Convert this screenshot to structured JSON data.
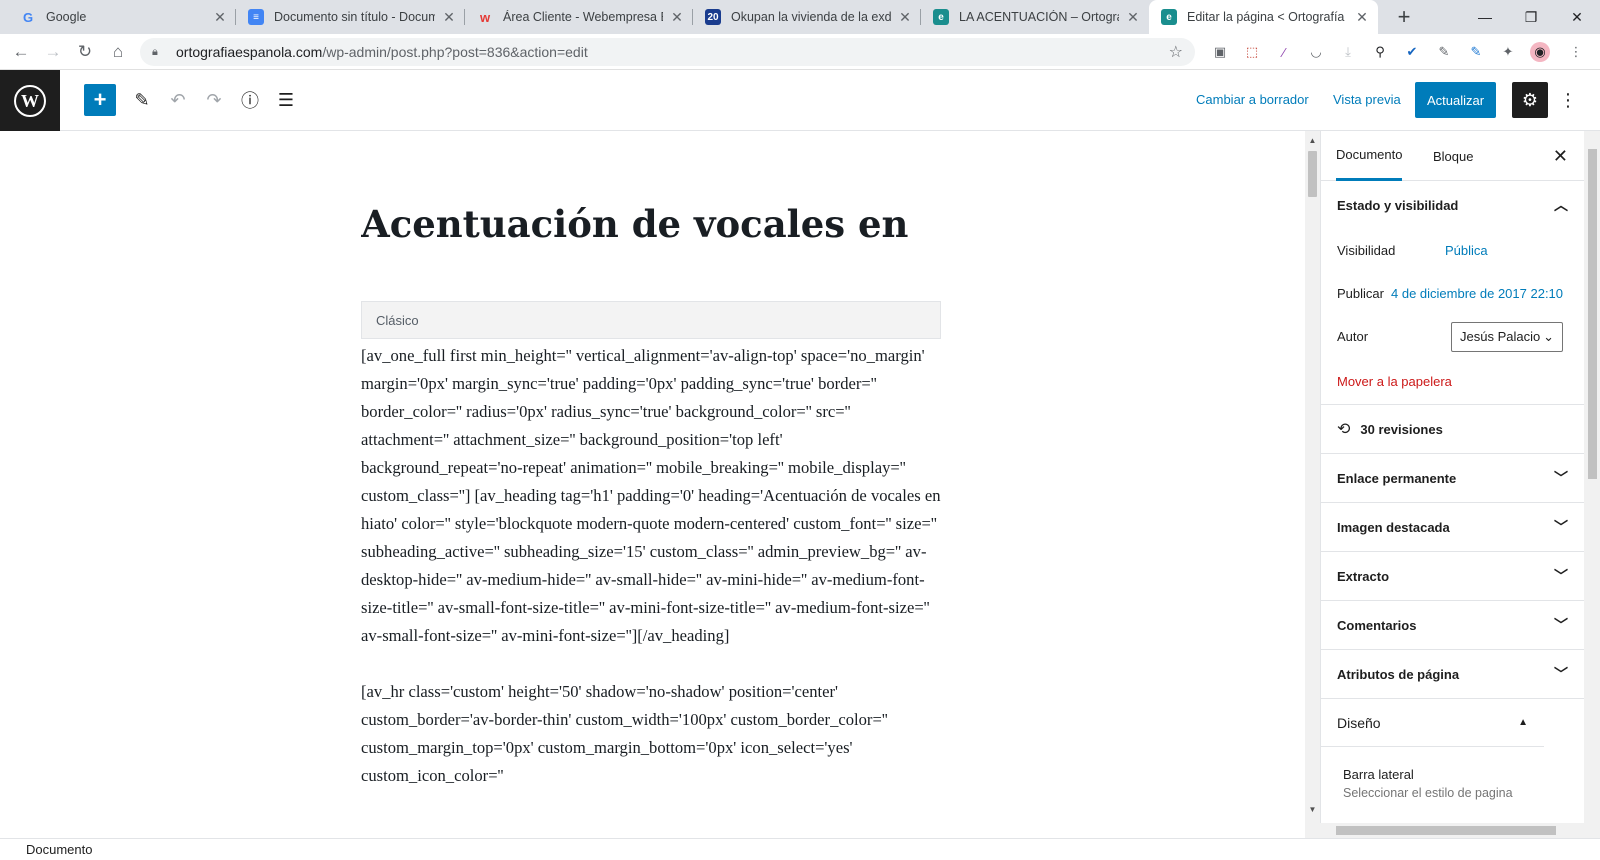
{
  "browser": {
    "tabs": [
      {
        "title": "Google",
        "favicon": "G",
        "favicon_color": "#4285f4"
      },
      {
        "title": "Documento sin título - Docum",
        "favicon": "≡",
        "favicon_color": "#4285f4"
      },
      {
        "title": "Área Cliente - Webempresa Eu",
        "favicon": "w",
        "favicon_color": "#e53935"
      },
      {
        "title": "Okupan la vivienda de la exdiri",
        "favicon": "20",
        "favicon_color": "#1a3c8e"
      },
      {
        "title": "LA ACENTUACIÓN – Ortografía",
        "favicon": "e",
        "favicon_color": "#1a8e8e"
      },
      {
        "title": "Editar la página < Ortografía e",
        "favicon": "e",
        "favicon_color": "#1a8e8e"
      }
    ],
    "url_host": "ortografiaespanola.com",
    "url_path": "/wp-admin/post.php?post=836&action=edit"
  },
  "wp_toolbar": {
    "switch_draft": "Cambiar a borrador",
    "preview": "Vista previa",
    "update": "Actualizar"
  },
  "editor": {
    "title": "Acentuación de vocales en hiato",
    "block_label": "Clásico",
    "paragraphs": [
      "[av_one_full first min_height='' vertical_alignment='av-align-top' space='no_margin' margin='0px' margin_sync='true' padding='0px' padding_sync='true' border='' border_color='' radius='0px' radius_sync='true' background_color='' src='' attachment='' attachment_size='' background_position='top left' background_repeat='no-repeat' animation='' mobile_breaking='' mobile_display='' custom_class=''] [av_heading tag='h1' padding='0' heading='Acentuación de vocales en hiato' color='' style='blockquote modern-quote modern-centered' custom_font='' size='' subheading_active='' subheading_size='15' custom_class='' admin_preview_bg='' av-desktop-hide='' av-medium-hide='' av-small-hide='' av-mini-hide='' av-medium-font-size-title='' av-small-font-size-title='' av-mini-font-size-title='' av-medium-font-size='' av-small-font-size='' av-mini-font-size=''][/av_heading]",
      "[av_hr class='custom' height='50' shadow='no-shadow' position='center' custom_border='av-border-thin' custom_width='100px' custom_border_color='' custom_margin_top='0px' custom_margin_bottom='0px' icon_select='yes' custom_icon_color=''"
    ]
  },
  "sidebar": {
    "tab_document": "Documento",
    "tab_block": "Bloque",
    "status_panel": "Estado y visibilidad",
    "visibility_label": "Visibilidad",
    "visibility_value": "Pública",
    "publish_label": "Publicar",
    "publish_value": "4 de diciembre de 2017 22:10",
    "author_label": "Autor",
    "author_value": "Jesús Palacio",
    "trash": "Mover a la papelera",
    "revisions": "30 revisiones",
    "panels": [
      "Enlace permanente",
      "Imagen destacada",
      "Extracto",
      "Comentarios",
      "Atributos de página"
    ],
    "design_panel": "Diseño",
    "sidebar_label": "Barra lateral",
    "sidebar_hint": "Seleccionar el estilo de pagina"
  },
  "footer": {
    "breadcrumb": "Documento"
  },
  "colors": {
    "accent": "#007cba",
    "danger": "#cc1818",
    "dark": "#1e1e1e"
  }
}
